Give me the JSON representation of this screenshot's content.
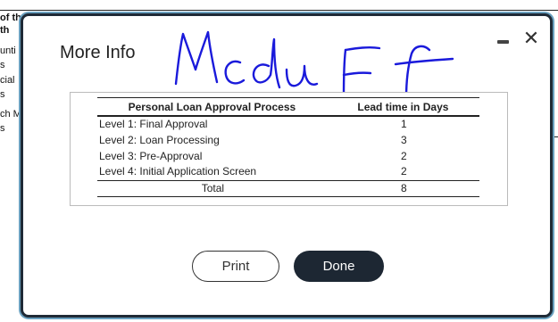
{
  "background": {
    "fragments": [
      "of th",
      "th",
      "unti",
      "s",
      "cial",
      "s",
      "ch M",
      "s"
    ]
  },
  "modal": {
    "title": "More Info",
    "signature_text": "McduFf",
    "close_icon": "close-icon",
    "minimize_icon": "minimize-icon"
  },
  "table": {
    "headers": [
      "Personal Loan Approval Process",
      "Lead time in Days"
    ],
    "rows": [
      {
        "process": "Level 1: Final Approval",
        "days": "1"
      },
      {
        "process": "Level 2: Loan Processing",
        "days": "3"
      },
      {
        "process": "Level 3: Pre-Approval",
        "days": "2"
      },
      {
        "process": "Level 4: Initial Application Screen",
        "days": "2"
      }
    ],
    "total_label": "Total",
    "total_days": "8"
  },
  "buttons": {
    "print_label": "Print",
    "done_label": "Done"
  },
  "colors": {
    "modal_border": "#1f2a36",
    "done_bg": "#1d2733",
    "signature_ink": "#1a1adb"
  }
}
